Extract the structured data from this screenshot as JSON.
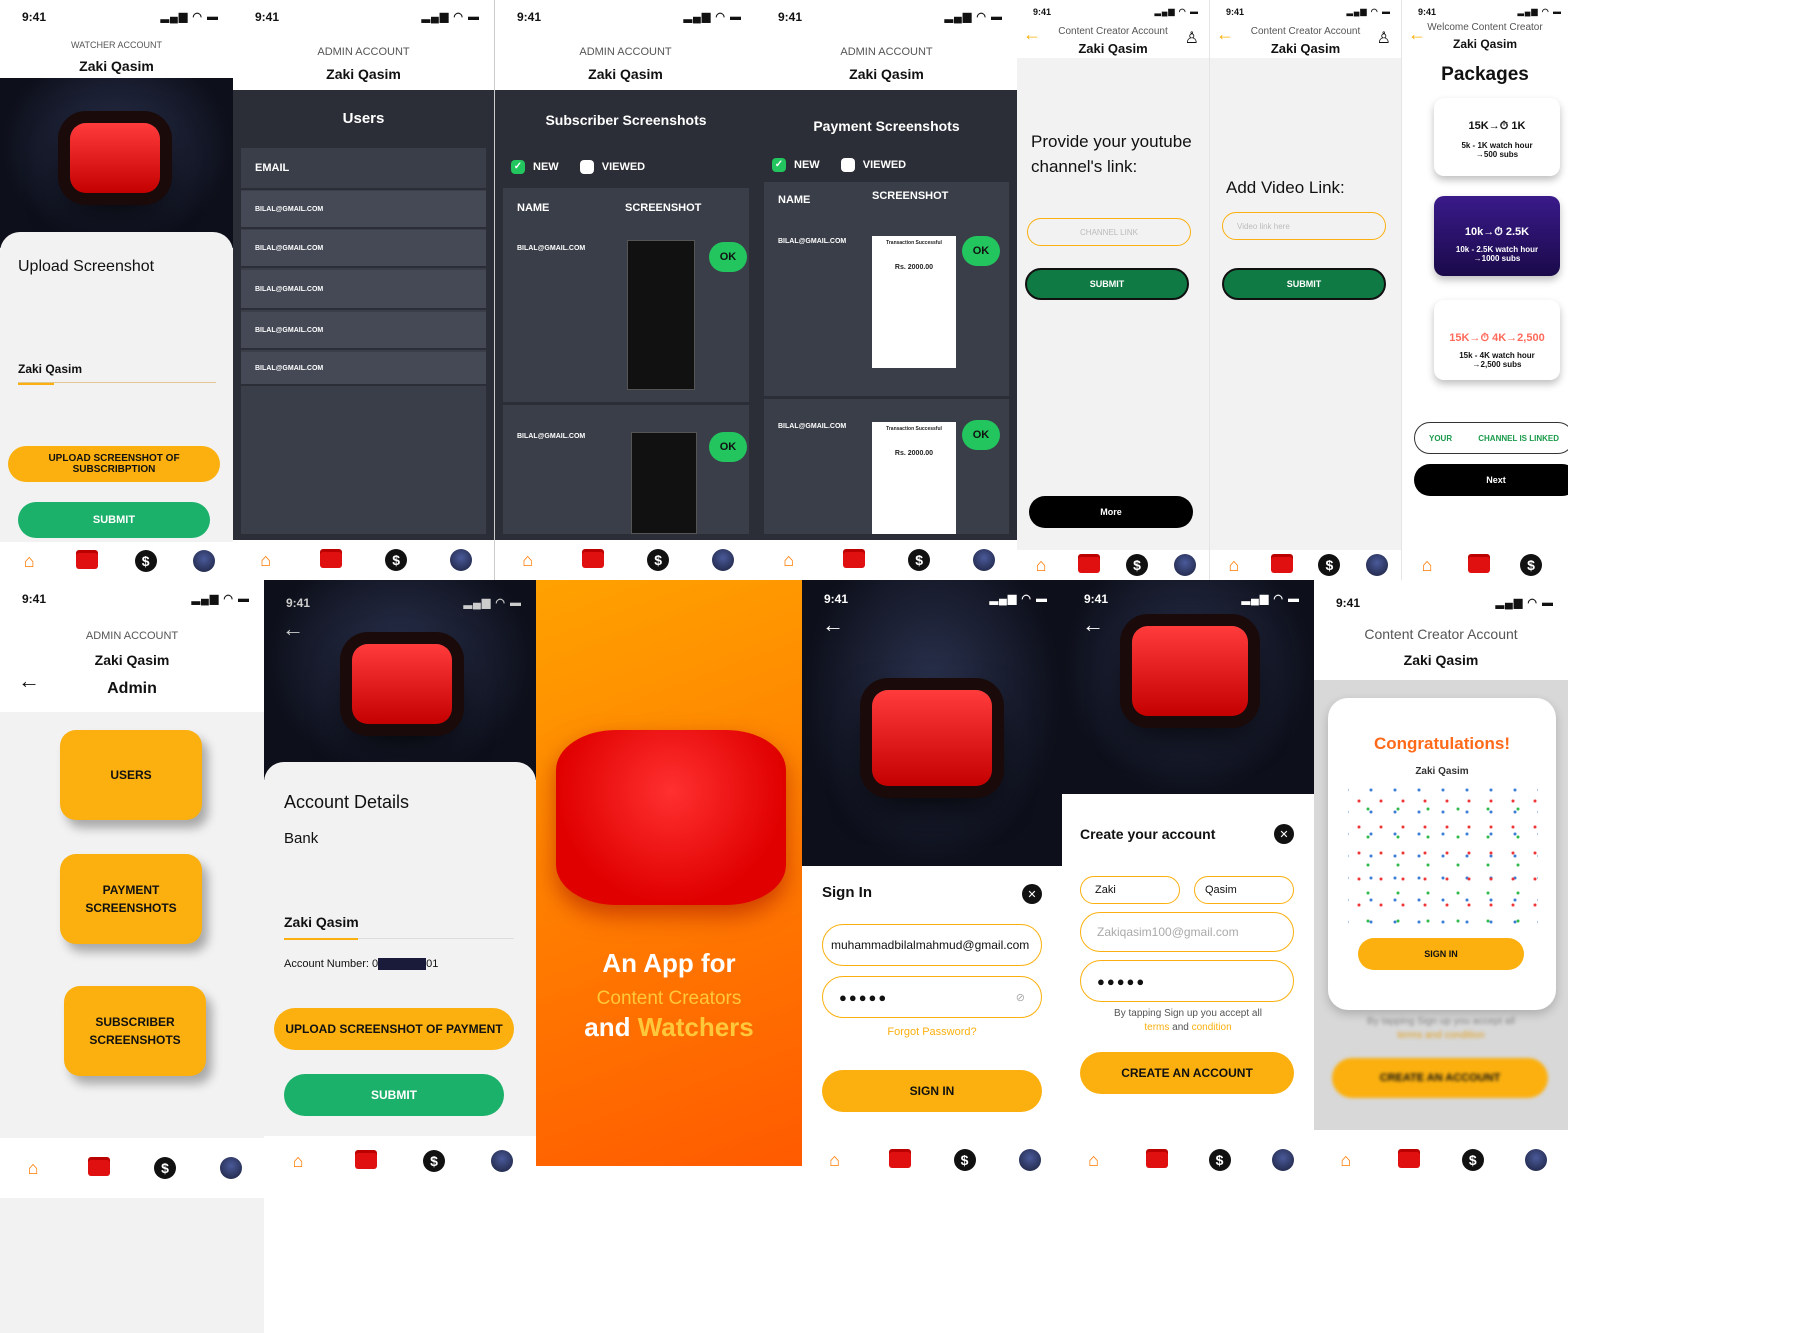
{
  "common": {
    "time": "9:41",
    "name": "Zaki Qasim",
    "status_icons": "▂▄▆ ◠ ▬"
  },
  "s1": {
    "account": "WATCHER ACCOUNT",
    "title": "Upload Screenshot",
    "field": "Zaki Qasim",
    "upload": "UPLOAD SCREENSHOT OF SUBSCRIBPTION",
    "submit": "SUBMIT"
  },
  "s2": {
    "account": "ADMIN ACCOUNT",
    "title": "Users",
    "col": "EMAIL",
    "rows": [
      "BILAL@GMAIL.COM",
      "BILAL@GMAIL.COM",
      "BILAL@GMAIL.COM",
      "BILAL@GMAIL.COM",
      "BILAL@GMAIL.COM"
    ]
  },
  "s3": {
    "account": "ADMIN ACCOUNT",
    "title": "Subscriber Screenshots",
    "new": "NEW",
    "viewed": "VIEWED",
    "col_name": "NAME",
    "col_shot": "SCREENSHOT",
    "rows": [
      "BILAL@GMAIL.COM",
      "BILAL@GMAIL.COM"
    ],
    "ok": "OK"
  },
  "s4": {
    "account": "ADMIN ACCOUNT",
    "title": "Payment Screenshots",
    "new": "NEW",
    "viewed": "VIEWED",
    "col_name": "NAME",
    "col_shot": "SCREENSHOT",
    "rows": [
      "BILAL@GMAIL.COM",
      "BILAL@GMAIL.COM"
    ],
    "ok": "OK",
    "receipt_title": "Transaction Successful",
    "receipt_amount": "Rs. 2000.00"
  },
  "s5": {
    "account": "Content Creator Account",
    "prompt": "Provide your youtube channel's link:",
    "placeholder": "CHANNEL LINK",
    "submit": "SUBMIT",
    "more": "More"
  },
  "s6": {
    "account": "Content Creator Account",
    "prompt": "Add Video Link:",
    "placeholder": "Video link here",
    "submit": "SUBMIT"
  },
  "s7": {
    "account": "Welcome Content Creator",
    "title": "Packages",
    "pkgs": [
      {
        "top": "15K→⏱ 1K",
        "line1": "5k - 1K watch hour",
        "line2": "→500 subs"
      },
      {
        "top": "10k→⏱ 2.5K",
        "line1": "10k - 2.5K watch hour",
        "line2": "→1000 subs"
      },
      {
        "top": "15K→⏱ 4K→2,500",
        "line1": "15k - 4K watch hour",
        "line2": "→2,500 subs"
      }
    ],
    "linked_left": "YOUR",
    "linked_right": "CHANNEL IS LINKED",
    "next": "Next"
  },
  "s8": {
    "account": "ADMIN ACCOUNT",
    "role": "Admin",
    "tiles": [
      "USERS",
      "PAYMENT SCREENSHOTS",
      "SUBSCRIBER SCREENSHOTS"
    ]
  },
  "s9": {
    "title": "Account Details",
    "bank": "Bank",
    "field": "Zaki Qasim",
    "acct_prefix": "Account Number: 0",
    "acct_suffix": "01",
    "upload": "UPLOAD SCREENSHOT OF PAYMENT",
    "submit": "SUBMIT"
  },
  "s10": {
    "line1": "An App for",
    "line2": "Content Creators",
    "line3a": "and ",
    "line3b": "Watchers"
  },
  "s11": {
    "title": "Sign In",
    "email": "muhammadbilalmahmud@gmail.com",
    "password": "●●●●●",
    "forgot": "Forgot Password?",
    "signin": "SIGN IN"
  },
  "s12": {
    "title": "Create your account",
    "first": "Zaki",
    "last": "Qasim",
    "email": "Zakiqasim100@gmail.com",
    "password": "●●●●●",
    "terms1": "By tapping Sign up you accept all",
    "terms2a": "terms",
    "terms2b": " and ",
    "terms2c": "condition",
    "create": "CREATE AN ACCOUNT"
  },
  "s13": {
    "account": "Content Creator Account",
    "congrats": "Congratulations!",
    "name": "Zaki Qasim",
    "signin": "SIGN IN",
    "terms1": "By tapping Sign up you accept all",
    "terms2": "terms and condition",
    "create": "CREATE AN ACCOUNT"
  },
  "colors": {
    "accent": "#fbb00f",
    "green": "#1cb16a",
    "dark": "#2b2e36",
    "red": "#e01010"
  }
}
